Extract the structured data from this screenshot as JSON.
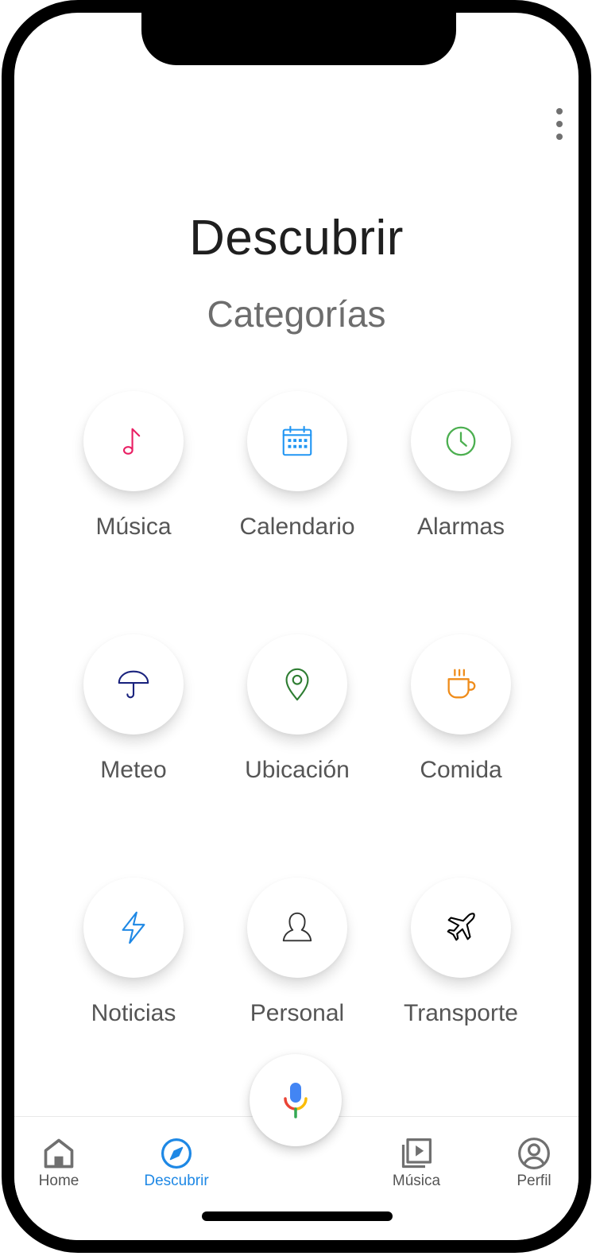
{
  "header": {
    "title": "Descubrir",
    "subtitle": "Categorías"
  },
  "categories": [
    {
      "label": "Música",
      "icon": "music-note-icon",
      "color": "#e91e63"
    },
    {
      "label": "Calendario",
      "icon": "calendar-icon",
      "color": "#2196f3"
    },
    {
      "label": "Alarmas",
      "icon": "clock-icon",
      "color": "#4caf50"
    },
    {
      "label": "Meteo",
      "icon": "umbrella-icon",
      "color": "#1a237e"
    },
    {
      "label": "Ubicación",
      "icon": "location-pin-icon",
      "color": "#2e7d32"
    },
    {
      "label": "Comida",
      "icon": "coffee-cup-icon",
      "color": "#ef8c1a"
    },
    {
      "label": "Noticias",
      "icon": "lightning-icon",
      "color": "#1e88e5"
    },
    {
      "label": "Personal",
      "icon": "person-icon",
      "color": "#333333"
    },
    {
      "label": "Transporte",
      "icon": "airplane-icon",
      "color": "#000000"
    }
  ],
  "voice": {
    "icon": "microphone-icon",
    "colors": [
      "#4285f4",
      "#ea4335",
      "#fbbc05",
      "#34a853"
    ]
  },
  "bottom_nav": [
    {
      "label": "Home",
      "icon": "home-icon",
      "active": false
    },
    {
      "label": "Descubrir",
      "icon": "compass-icon",
      "active": true
    },
    {
      "label": "Música",
      "icon": "video-library-icon",
      "active": false
    },
    {
      "label": "Perfil",
      "icon": "account-circle-icon",
      "active": false
    }
  ],
  "accent": "#1e88e5"
}
